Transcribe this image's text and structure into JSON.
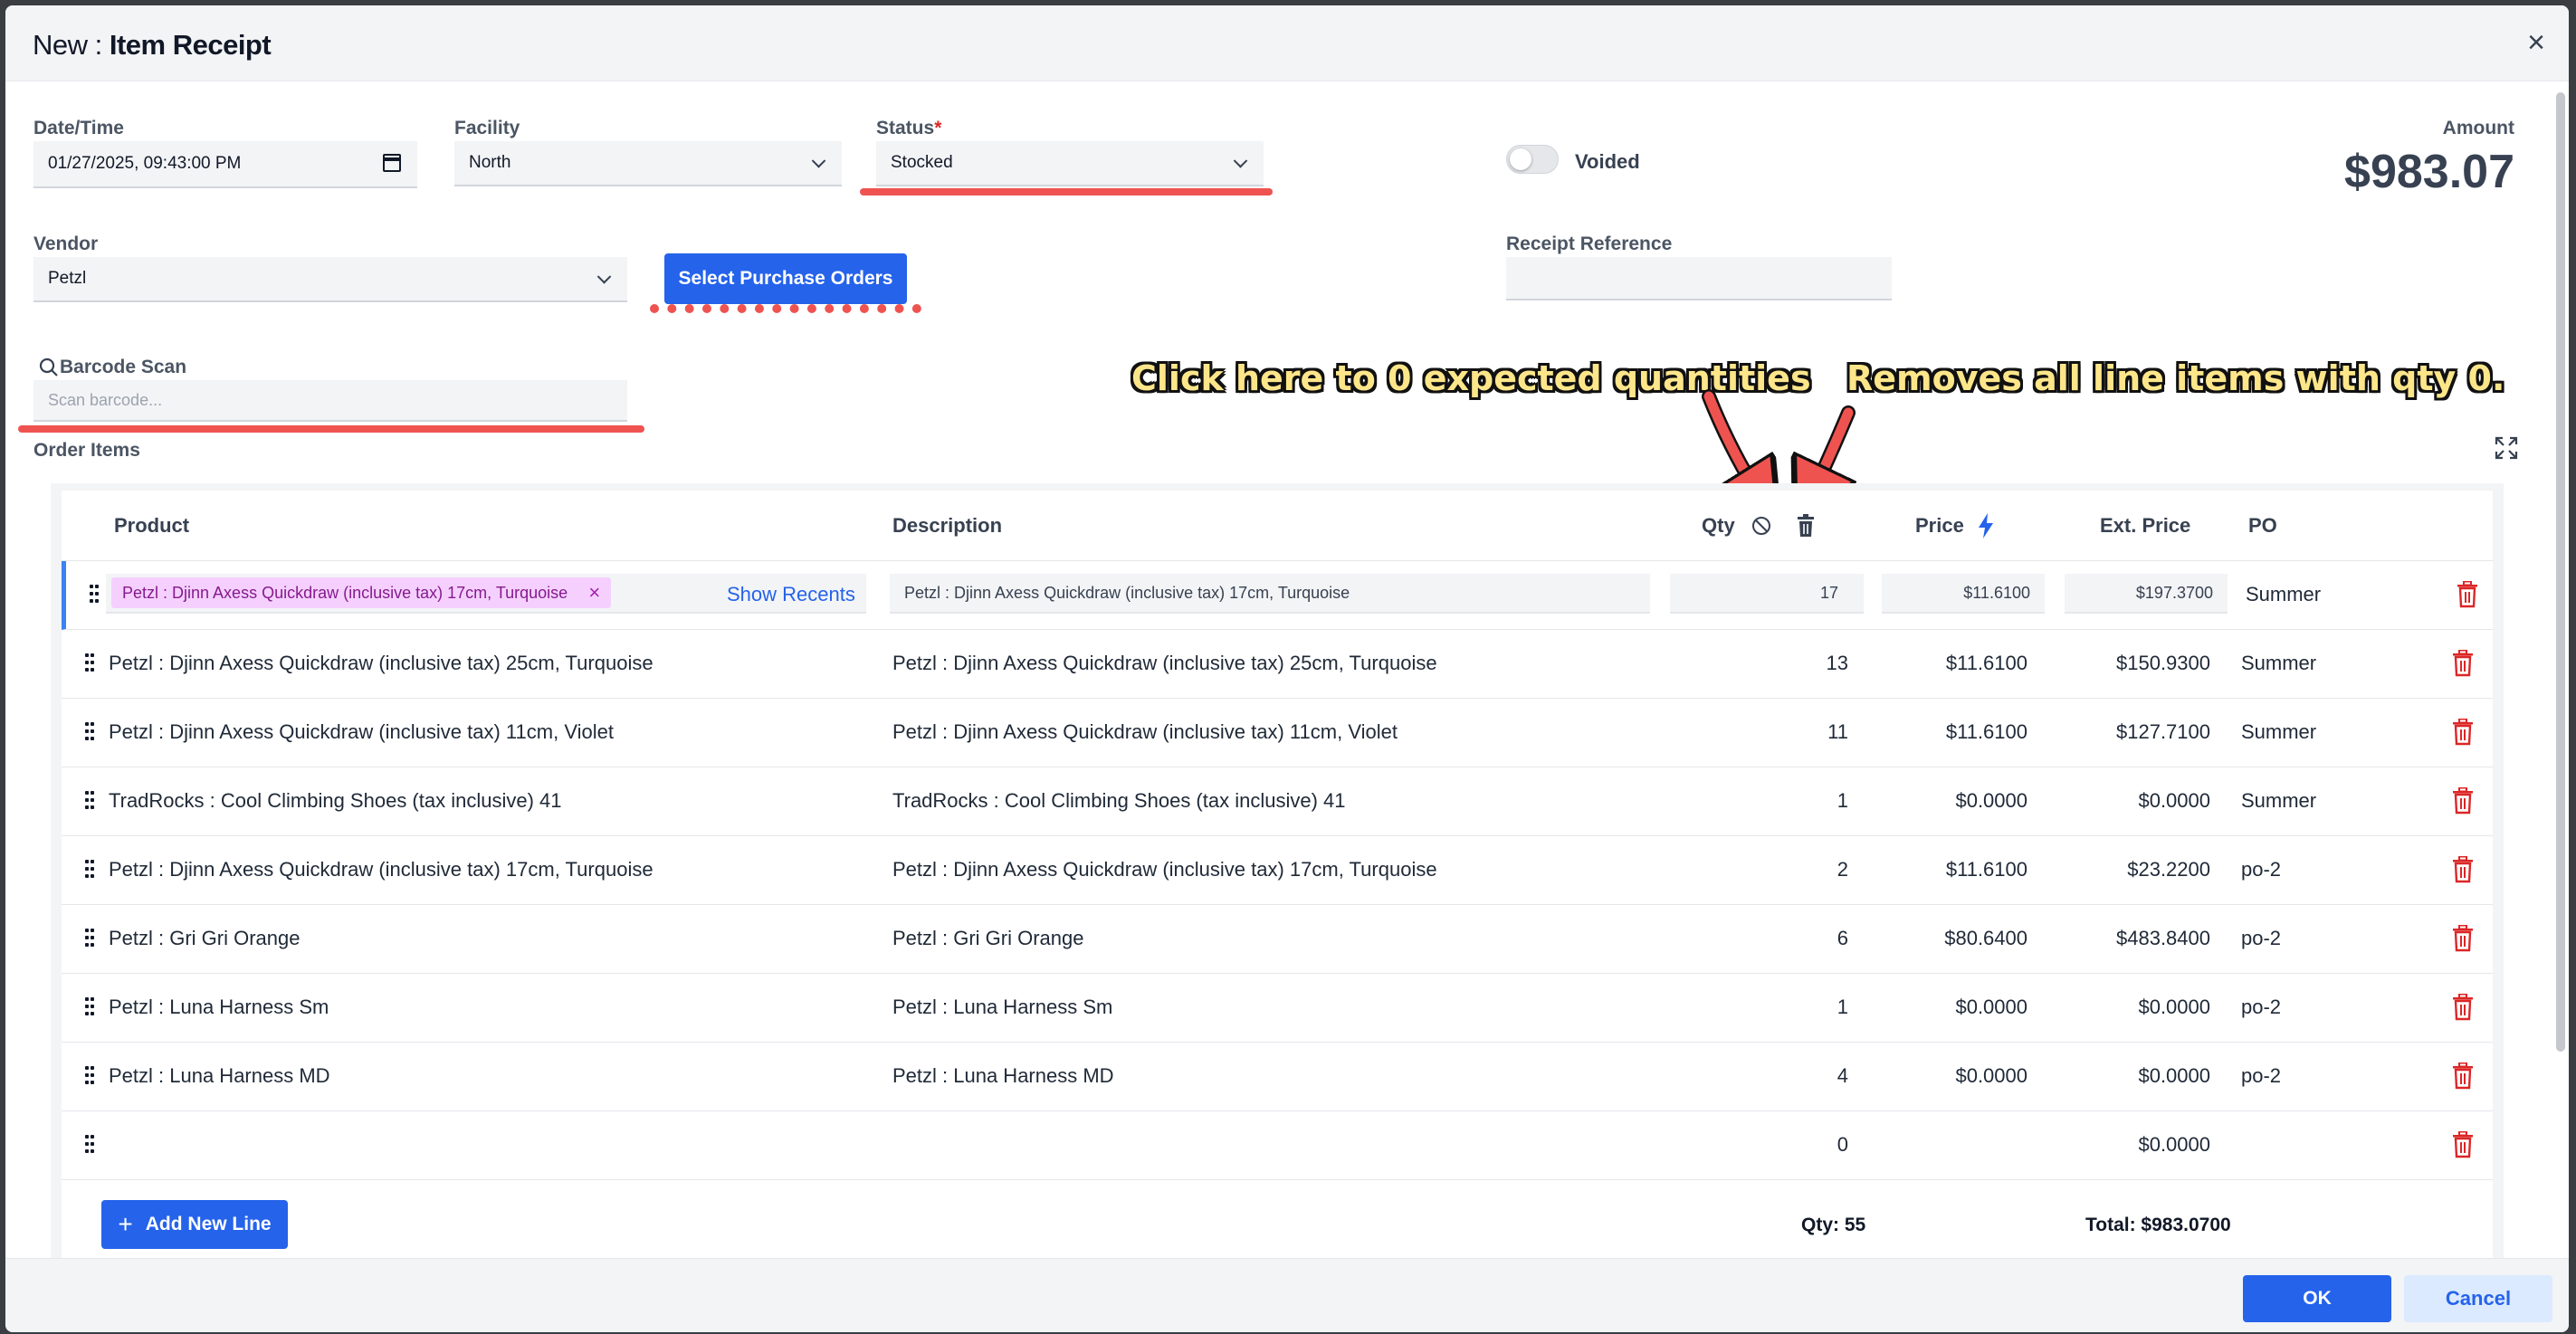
{
  "header": {
    "title_prefix": "New : ",
    "title_main": "Item Receipt"
  },
  "form": {
    "datetime": {
      "label": "Date/Time",
      "value": "01/27/2025, 09:43:00 PM"
    },
    "facility": {
      "label": "Facility",
      "value": "North"
    },
    "status": {
      "label": "Status",
      "required_mark": "*",
      "value": "Stocked"
    },
    "voided": {
      "label": "Voided",
      "checked": false
    },
    "amount": {
      "label": "Amount",
      "value": "$983.07"
    },
    "vendor": {
      "label": "Vendor",
      "value": "Petzl"
    },
    "select_po_button": "Select Purchase Orders",
    "receipt_reference": {
      "label": "Receipt Reference",
      "value": ""
    },
    "barcode": {
      "label": "Barcode Scan",
      "placeholder": "Scan barcode..."
    }
  },
  "annotations": {
    "zero_qty": "Click here to 0 expected quantities",
    "remove_zero": "Removes all line items with qty 0."
  },
  "order_items": {
    "label": "Order Items",
    "columns": {
      "product": "Product",
      "description": "Description",
      "qty": "Qty",
      "price": "Price",
      "ext_price": "Ext. Price",
      "po": "PO"
    },
    "active_row": {
      "product_tag": "Petzl : Djinn Axess Quickdraw (inclusive tax) 17cm, Turquoise",
      "show_recents": "Show Recents",
      "description": "Petzl : Djinn Axess Quickdraw (inclusive tax) 17cm, Turquoise",
      "qty": "17",
      "price": "$11.6100",
      "ext_price": "$197.3700",
      "po": "Summer"
    },
    "rows": [
      {
        "product": "Petzl : Djinn Axess Quickdraw (inclusive tax) 25cm, Turquoise",
        "description": "Petzl : Djinn Axess Quickdraw (inclusive tax) 25cm, Turquoise",
        "qty": "13",
        "price": "$11.6100",
        "ext_price": "$150.9300",
        "po": "Summer"
      },
      {
        "product": "Petzl : Djinn Axess Quickdraw (inclusive tax) 11cm, Violet",
        "description": "Petzl : Djinn Axess Quickdraw (inclusive tax) 11cm, Violet",
        "qty": "11",
        "price": "$11.6100",
        "ext_price": "$127.7100",
        "po": "Summer"
      },
      {
        "product": "TradRocks : Cool Climbing Shoes (tax inclusive) 41",
        "description": "TradRocks : Cool Climbing Shoes (tax inclusive) 41",
        "qty": "1",
        "price": "$0.0000",
        "ext_price": "$0.0000",
        "po": "Summer"
      },
      {
        "product": "Petzl : Djinn Axess Quickdraw (inclusive tax) 17cm, Turquoise",
        "description": "Petzl : Djinn Axess Quickdraw (inclusive tax) 17cm, Turquoise",
        "qty": "2",
        "price": "$11.6100",
        "ext_price": "$23.2200",
        "po": "po-2"
      },
      {
        "product": "Petzl : Gri Gri Orange",
        "description": "Petzl : Gri Gri Orange",
        "qty": "6",
        "price": "$80.6400",
        "ext_price": "$483.8400",
        "po": "po-2"
      },
      {
        "product": "Petzl : Luna Harness Sm",
        "description": "Petzl : Luna Harness Sm",
        "qty": "1",
        "price": "$0.0000",
        "ext_price": "$0.0000",
        "po": "po-2"
      },
      {
        "product": "Petzl : Luna Harness MD",
        "description": "Petzl : Luna Harness MD",
        "qty": "4",
        "price": "$0.0000",
        "ext_price": "$0.0000",
        "po": "po-2"
      },
      {
        "product": "",
        "description": "",
        "qty": "0",
        "price": "",
        "ext_price": "$0.0000",
        "po": ""
      }
    ],
    "add_line_button": "Add New Line",
    "total_qty": "Qty: 55",
    "total_amount": "Total: $983.0700"
  },
  "footer": {
    "ok": "OK",
    "cancel": "Cancel"
  },
  "colors": {
    "primary": "#2563eb",
    "annotation_red": "#ef5350",
    "trash_red": "#dc2626",
    "tag_bg": "#f5d0fe"
  }
}
